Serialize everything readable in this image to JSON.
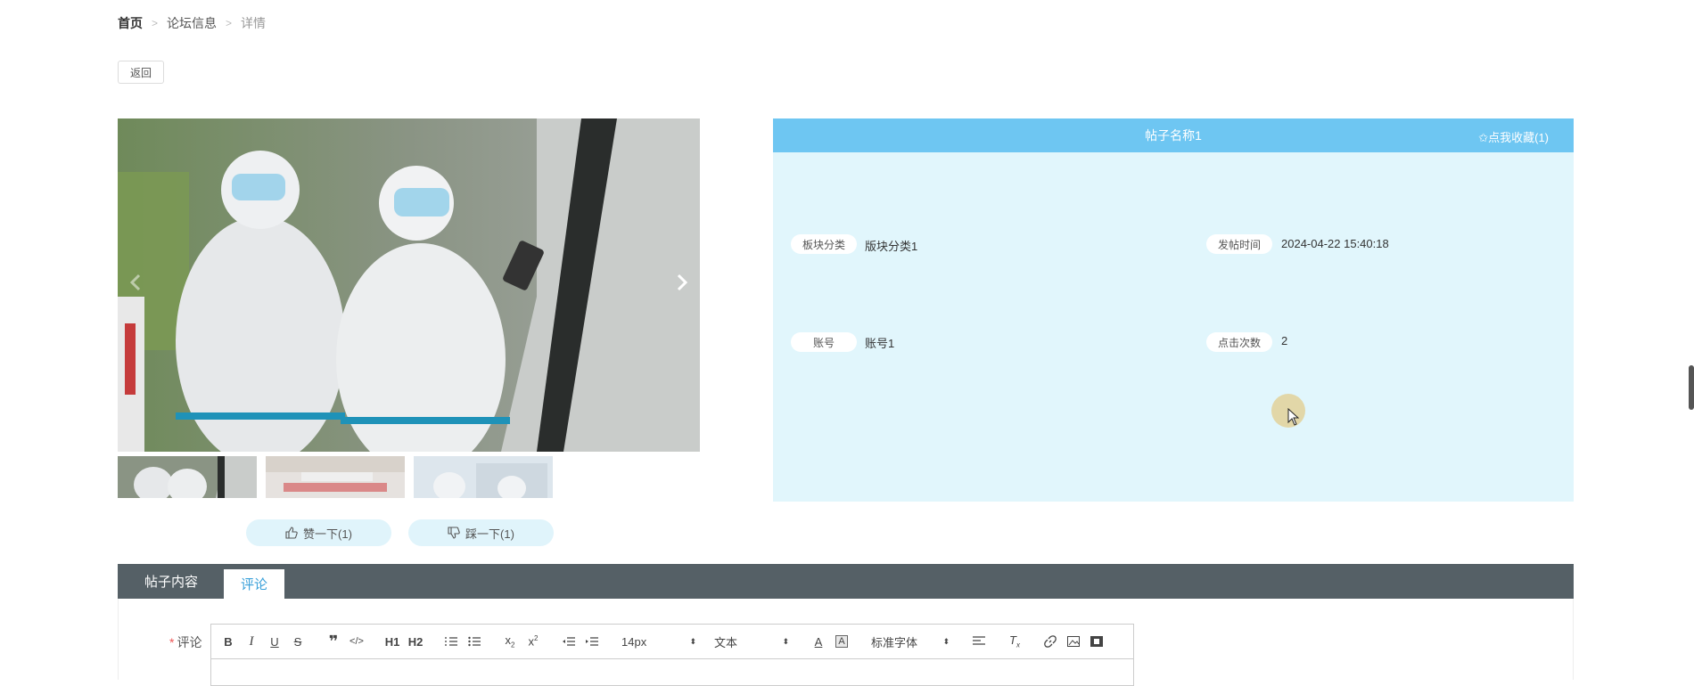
{
  "breadcrumb": {
    "home": "首页",
    "forum": "论坛信息",
    "current": "详情",
    "separator": ">"
  },
  "back_button": "返回",
  "post": {
    "title": "帖子名称1",
    "collect": "✩点我收藏(1)",
    "fields": [
      {
        "label": "板块分类",
        "value": "版块分类1"
      },
      {
        "label": "发帖时间",
        "value": "2024-04-22 15:40:18"
      },
      {
        "label": "账号",
        "value": "账号1"
      },
      {
        "label": "点击次数",
        "value": "2"
      }
    ]
  },
  "votes": {
    "like": "赞一下(1)",
    "dislike": "踩一下(1)"
  },
  "tabs": [
    {
      "label": "帖子内容"
    },
    {
      "label": "评论",
      "active": true
    }
  ],
  "comment": {
    "required_mark": "*",
    "label": "评论",
    "toolbar": {
      "font_size": "14px",
      "text_type": "文本",
      "font_family": "标准字体",
      "h1": "H1",
      "h2": "H2"
    }
  },
  "colors": {
    "panel_header": "#6ec6f2",
    "panel_bg": "#e1f6fc",
    "tabbar": "#556066",
    "active_tab_text": "#39a0d9",
    "vote_bg": "#e0f4fb"
  }
}
